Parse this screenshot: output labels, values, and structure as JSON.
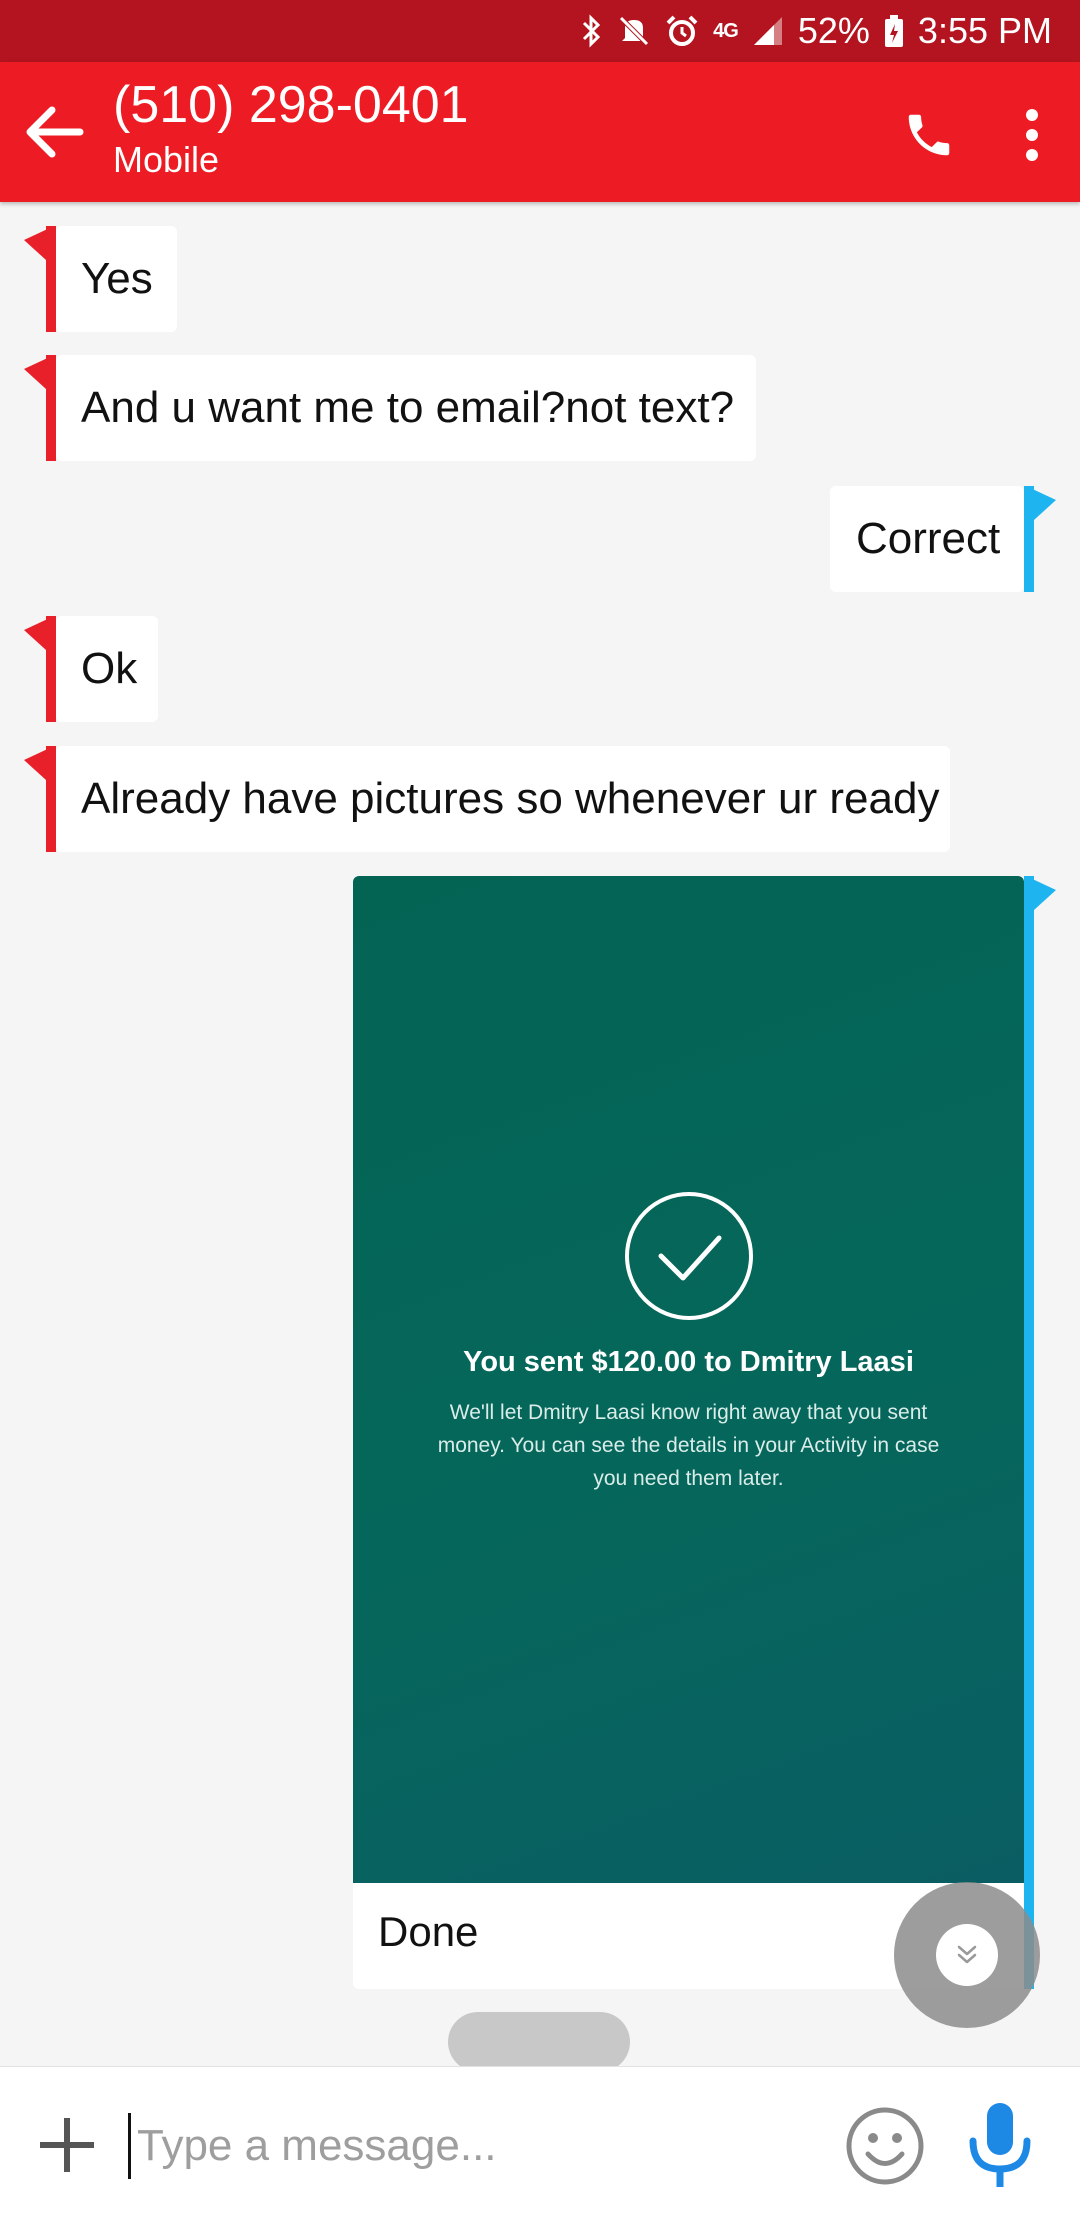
{
  "status_bar": {
    "battery": "52%",
    "time": "3:55 PM",
    "network": "4G",
    "icons": [
      "bluetooth-icon",
      "mute-icon",
      "alarm-icon",
      "network-4g-icon",
      "signal-icon",
      "battery-icon"
    ]
  },
  "header": {
    "contact_number": "(510) 298-0401",
    "contact_type": "Mobile",
    "icons": [
      "back-arrow-icon",
      "phone-icon",
      "more-vert-icon"
    ]
  },
  "messages": [
    {
      "direction": "incoming",
      "text": "Yes"
    },
    {
      "direction": "incoming",
      "text": "And u want me to email?not text?"
    },
    {
      "direction": "outgoing",
      "text": "Correct"
    },
    {
      "direction": "incoming",
      "text": "Ok"
    },
    {
      "direction": "incoming",
      "text": "Already have pictures so whenever ur ready"
    }
  ],
  "attachment": {
    "title": "You sent $120.00 to Dmitry Laasi",
    "body": "We'll let Dmitry Laasi know right away that you sent money. You can see the details in your Activity in case you need them later.",
    "footer": "Done"
  },
  "composer": {
    "placeholder": "Type a message..."
  },
  "colors": {
    "status_bar": "#b3141f",
    "app_bar": "#ed1c24",
    "incoming_accent": "#e8202a",
    "outgoing_accent": "#1eb4f0",
    "attachment_bg": "#046454",
    "mic": "#1e88e5"
  }
}
